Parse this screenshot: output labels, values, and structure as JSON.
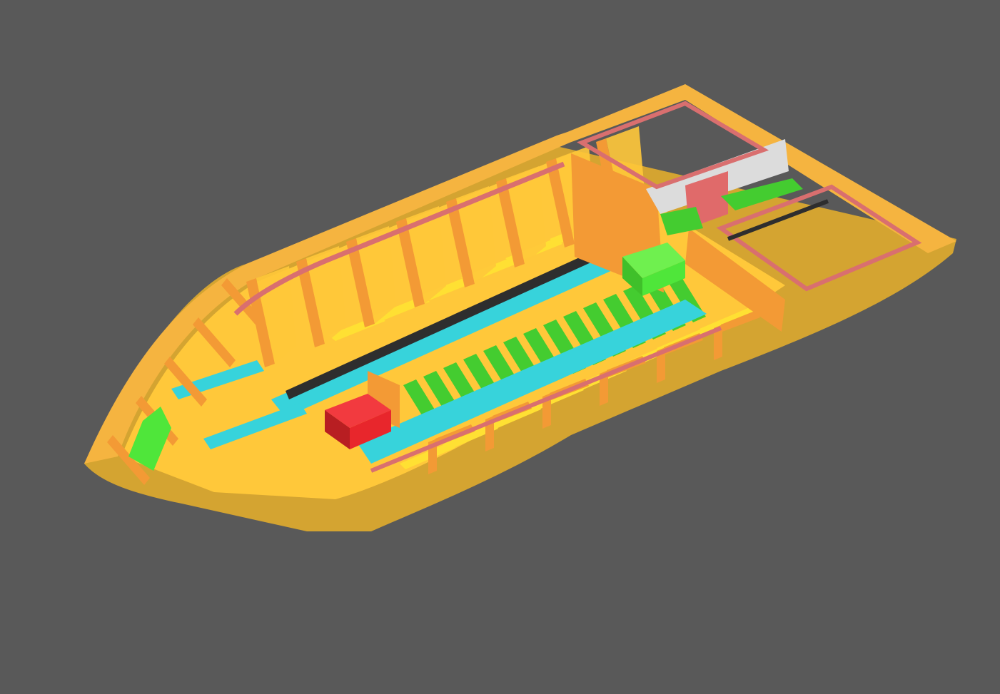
{
  "viewport": {
    "background": "#595959"
  },
  "model": {
    "colors": {
      "hull_side": "#D4A431",
      "hull_top": "#F5B440",
      "deck_orange": "#F39A35",
      "frame_yellow": "#FFC83A",
      "floor_yellow": "#FFE033",
      "stringer_cyan": "#37D3DB",
      "floor_green": "#44CC30",
      "rail_pink": "#D96F6F",
      "engine_green": "#4FE63A",
      "engine_red": "#E8262C",
      "panel_white": "#DCDCDC",
      "panel_pink": "#E06A6A",
      "shadow_dark": "#2E2E2E"
    }
  }
}
